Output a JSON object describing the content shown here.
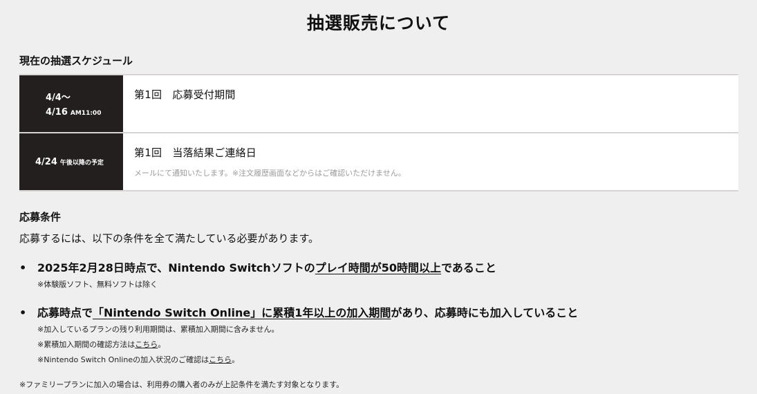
{
  "page": {
    "title": "抽選販売について"
  },
  "schedule": {
    "heading": "現在の抽選スケジュール",
    "rows": [
      {
        "date_line1": "4/4〜",
        "date_line2": "4/16",
        "date_small": "AM11:00",
        "title": "第1回　応募受付期間",
        "note": ""
      },
      {
        "date_line1": "4/24",
        "date_small": "午後以降の予定",
        "title": "第1回　当落結果ご連絡日",
        "note": "メールにて通知いたします。※注文履歴画面などからはご確認いただけません。"
      }
    ]
  },
  "conditions": {
    "heading": "応募条件",
    "intro": "応募するには、以下の条件を全て満たしている必要があります。",
    "bullet": "•",
    "items": [
      {
        "pre": "2025年2月28日時点で、Nintendo Switchソフトの",
        "underlined": "プレイ時間が50時間以上",
        "post": "であること",
        "notes": [
          "※体験版ソフト、無料ソフトは除く"
        ]
      },
      {
        "pre": "応募時点で",
        "underlined": "「Nintendo Switch Online」に累積1年以上の加入期間",
        "post": "があり、応募時にも加入していること",
        "notes": [
          "※加入しているプランの残り利用期間は、累積加入期間に含みません。"
        ],
        "link_notes": [
          {
            "pre": "※累積加入期間の確認方法は",
            "link": "こちら",
            "post": "。"
          },
          {
            "pre": "※Nintendo Switch Onlineの加入状況のご確認は",
            "link": "こちら",
            "post": "。"
          }
        ]
      }
    ]
  },
  "footer": {
    "note": "※ファミリープランに加入の場合は、利用券の購入者のみが上記条件を満たす対象となります。"
  }
}
